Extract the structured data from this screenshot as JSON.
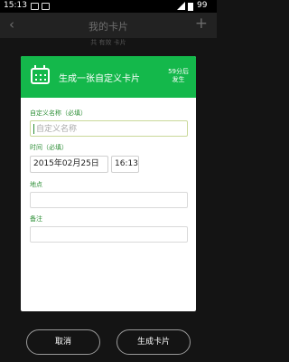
{
  "statusbar": {
    "time": "15:13",
    "battery": "99"
  },
  "appbar": {
    "back": "‹",
    "title": "我的卡片",
    "add": "+"
  },
  "subhead": "共 有效 卡片",
  "dialog": {
    "title": "生成一张自定义卡片",
    "countdown": [
      "59分后",
      "发生"
    ],
    "name_label": "自定义名称（必填）",
    "name_placeholder": "自定义名称",
    "time_label": "时间（必填）",
    "date_value": "2015年02月25日",
    "time_value": "16:13",
    "location_label": "地点",
    "note_label": "备注"
  },
  "buttons": {
    "cancel": "取消",
    "create": "生成卡片"
  },
  "colors": {
    "accent": "#14b84b",
    "label": "#2e8f37"
  }
}
